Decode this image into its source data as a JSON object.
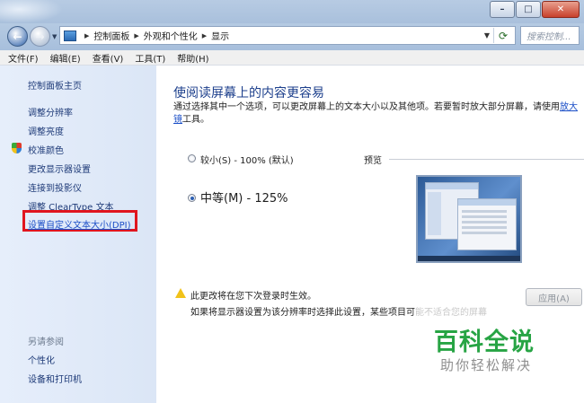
{
  "window": {
    "minimize": "–",
    "maximize": "□",
    "close": "✕"
  },
  "address": {
    "back": "←",
    "forward": "→",
    "crumbs": [
      "控制面板",
      "外观和个性化",
      "显示"
    ],
    "search_placeholder": "搜索控制..."
  },
  "menu": {
    "items": [
      "文件(F)",
      "编辑(E)",
      "查看(V)",
      "工具(T)",
      "帮助(H)"
    ]
  },
  "sidebar": {
    "home": "控制面板主页",
    "items": [
      "调整分辨率",
      "调整亮度",
      "校准颜色",
      "更改显示器设置",
      "连接到投影仪",
      "调整 ClearType 文本",
      "设置自定义文本大小(DPI)"
    ],
    "see_also": "另请参阅",
    "see_also_items": [
      "个性化",
      "设备和打印机"
    ]
  },
  "main": {
    "title": "使阅读屏幕上的内容更容易",
    "desc_line1": "通过选择其中一个选项，可以更改屏幕上的文本大小以及其他项。若要暂时放大部分屏幕，请使用",
    "desc_link1": "放大",
    "desc_link2": "镜",
    "desc_tail": "工具。",
    "option_small": "较小(S) - 100% (默认)",
    "option_medium": "中等(M) - 125%",
    "selected_option": "medium",
    "preview_label": "预览",
    "warning": "此更改将在您下次登录时生效。",
    "warning2": "如果将显示器设置为该分辨率时选择此设置，某些项目可能不适合您的屏幕",
    "apply": "应用(A)"
  },
  "watermark": {
    "title": "百科全说",
    "subtitle": "助你轻松解决"
  },
  "colors": {
    "accent_link": "#1a4ec7",
    "title_blue": "#1c3f8c",
    "highlight_red": "#e0151f",
    "watermark_green": "#27a444"
  }
}
